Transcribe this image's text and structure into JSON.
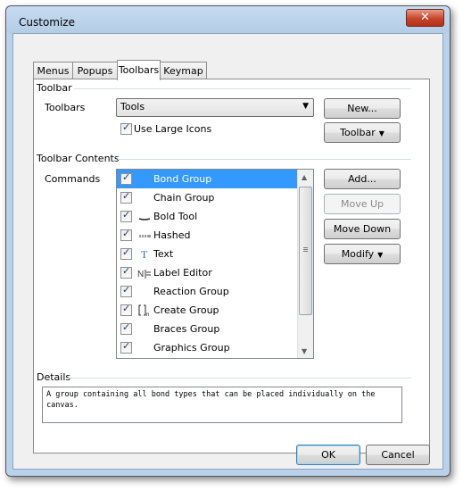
{
  "window": {
    "title": "Customize",
    "close_glyph": "✕"
  },
  "tabs": [
    {
      "label": "Menus"
    },
    {
      "label": "Popups"
    },
    {
      "label": "Toolbars",
      "active": true
    },
    {
      "label": "Keymap"
    }
  ],
  "toolbar_group": {
    "label": "Toolbar",
    "toolbars_label": "Toolbars",
    "toolbars_value": "Tools",
    "use_large_icons_label": "Use Large Icons",
    "use_large_icons_checked": true,
    "new_button": "New...",
    "toolbar_button": "Toolbar"
  },
  "contents_group": {
    "label": "Toolbar Contents",
    "commands_label": "Commands",
    "add_button": "Add...",
    "move_up_button": "Move Up",
    "move_down_button": "Move Down",
    "modify_button": "Modify",
    "commands": [
      {
        "label": "Bond Group",
        "checked": true,
        "selected": true,
        "icon": "none"
      },
      {
        "label": "Chain Group",
        "checked": true,
        "icon": "none"
      },
      {
        "label": "Bold Tool",
        "checked": true,
        "icon": "bold-bond-icon"
      },
      {
        "label": "Hashed",
        "checked": true,
        "icon": "hashed-bond-icon"
      },
      {
        "label": "Text",
        "checked": true,
        "icon": "text-icon"
      },
      {
        "label": "Label Editor",
        "checked": true,
        "icon": "label-editor-icon"
      },
      {
        "label": "Reaction Group",
        "checked": true,
        "icon": "none"
      },
      {
        "label": "Create Group",
        "checked": true,
        "icon": "create-group-icon"
      },
      {
        "label": "Braces Group",
        "checked": true,
        "icon": "none"
      },
      {
        "label": "Graphics Group",
        "checked": true,
        "icon": "none"
      }
    ]
  },
  "details_group": {
    "label": "Details",
    "text": "A group containing all bond types that can be placed individually on the canvas."
  },
  "footer": {
    "ok_button": "OK",
    "cancel_button": "Cancel"
  },
  "colors": {
    "selection": "#3399ff",
    "frame": "#b9d1ea"
  }
}
